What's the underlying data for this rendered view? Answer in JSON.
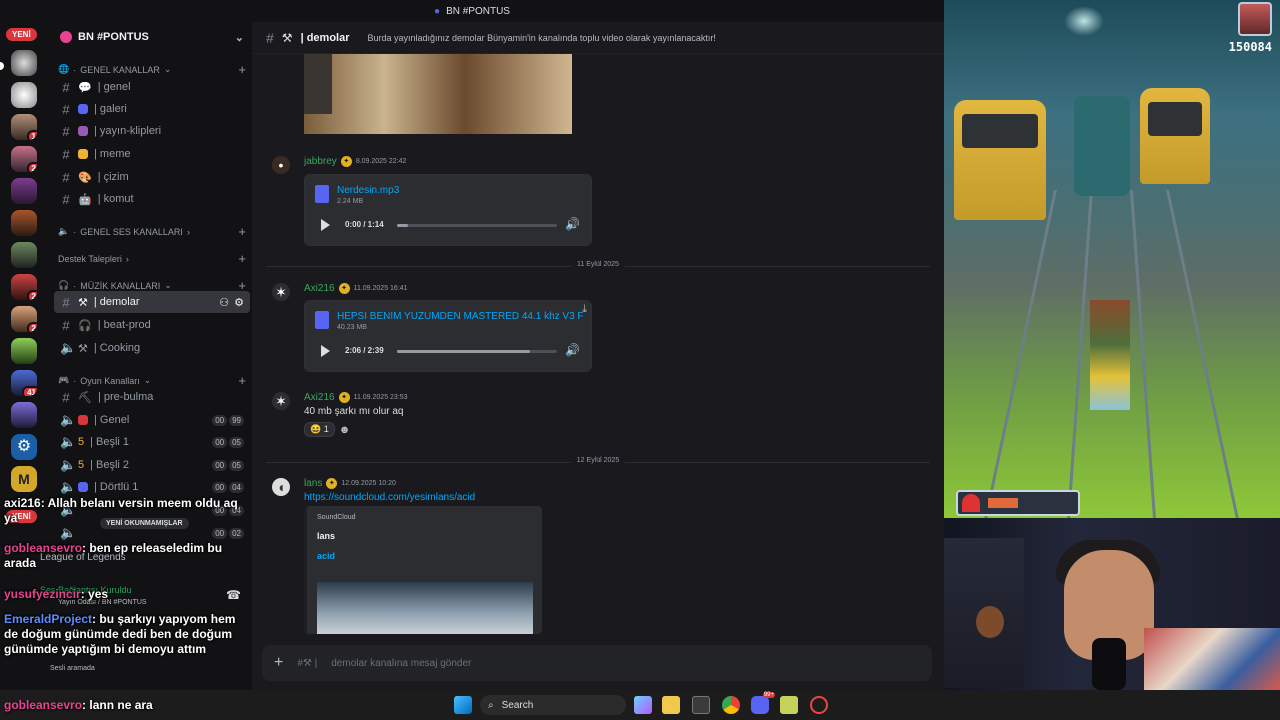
{
  "titlebar": {
    "title": "BN #PONTUS",
    "arrows": "← →"
  },
  "servers": {
    "new_label": "YENİ",
    "new_label2": "YENİ",
    "badges": [
      "1",
      "2",
      "2",
      "2",
      "41",
      "2"
    ]
  },
  "sidebar": {
    "server_name": "BN #PONTUS",
    "categories": {
      "genel_kanallar": "GENEL KANALLAR",
      "genel_ses": "GENEL SES KANALLARI",
      "destek": "Destek Talepleri",
      "muzik": "MÜZİK KANALLARI",
      "oyun": "Oyun Kanalları"
    },
    "channels": {
      "genel": "| genel",
      "galeri": "| galeri",
      "yayin": "| yayın-klipleri",
      "meme": "| meme",
      "cizim": "| çizim",
      "komut": "| komut",
      "demolar": "| demolar",
      "beatprod": "| beat-prod",
      "cooking": "| Cooking",
      "prebulma": "| pre-bulma",
      "vgenel": "| Genel",
      "besli1": "| Beşli 1",
      "besli2": "| Beşli 2",
      "dortlu1": "| Dörtlü 1"
    },
    "counts": {
      "vgenel": [
        "00",
        "99"
      ],
      "besli1": [
        "00",
        "05"
      ],
      "besli2": [
        "00",
        "05"
      ],
      "dortlu1": [
        "00",
        "04"
      ],
      "row5": [
        "00",
        "04"
      ],
      "row6": [
        "00",
        "02"
      ]
    },
    "unread_label": "YENİ OKUNMAMIŞLAR",
    "voice_status": "League of Legends",
    "voice_conn": "Ses Bağlantısı Kuruldu",
    "voice_room": "Yayın Odası / BN #PONTUS",
    "voice_search": "Sesli aramada"
  },
  "channel_header": {
    "name": "| demolar",
    "topic": "Burda yayınladığınız demolar Bünyamin'in kanalında toplu video olarak yayınlanacaktır!"
  },
  "messages": [
    {
      "user": "jabbrey",
      "time": "8.09.2025 22:42",
      "file": "Nerdesin.mp3",
      "size": "2.24 MB",
      "audio_time": "0:00 / 1:14",
      "progress": 0.07
    },
    {
      "date": "11 Eylül 2025"
    },
    {
      "user": "Axi216",
      "time": "11.09.2025 16:41",
      "file": "HEPSI BENIM YUZUMDEN MASTERED 44.1 khz V3 FIN...",
      "size": "40.23 MB",
      "audio_time": "2:06 / 2:39",
      "progress": 0.83
    },
    {
      "user": "Axi216",
      "time": "11.09.2025 23:53",
      "text": "40 mb şarkı mı olur aq",
      "reaction_count": "1",
      "reaction_emoji": "😆",
      "add_reaction": "☻"
    },
    {
      "date": "12 Eylül 2025"
    },
    {
      "user": "lans",
      "time": "12.09.2025 10:20",
      "link": "https://soundcloud.com/yesimlans/acid",
      "embed_provider": "SoundCloud",
      "embed_author": "lans",
      "embed_title": "acid"
    }
  ],
  "composer": {
    "placeholder": "demolar kanalına mesaj gönder"
  },
  "game": {
    "score": "150084"
  },
  "overlay_chat": [
    {
      "user": "axi216",
      "text": ": Allah belanı versin meem oldu aq ya",
      "color": "#ffffff"
    },
    {
      "user": "gobleansevro",
      "text": ": ben ep releaseledim bu arada",
      "color": "#e84393"
    },
    {
      "user": "yusufyezincir",
      "text": ": yes",
      "color": "#e84393"
    },
    {
      "user": "EmeraldProject",
      "text": ": bu şarkıyı yapıyom hem de doğum günümde dedi ben de doğum günümde yaptığım bi demoyu attım",
      "color": "#5b8cff"
    },
    {
      "user": "gobleansevro",
      "text": ": lann ne ara",
      "color": "#e84393"
    }
  ],
  "taskbar": {
    "search": "Search",
    "notif": "99+"
  },
  "colors": {
    "accent": "#5865f2",
    "link": "#00a8fc",
    "mention": "#da373c"
  }
}
